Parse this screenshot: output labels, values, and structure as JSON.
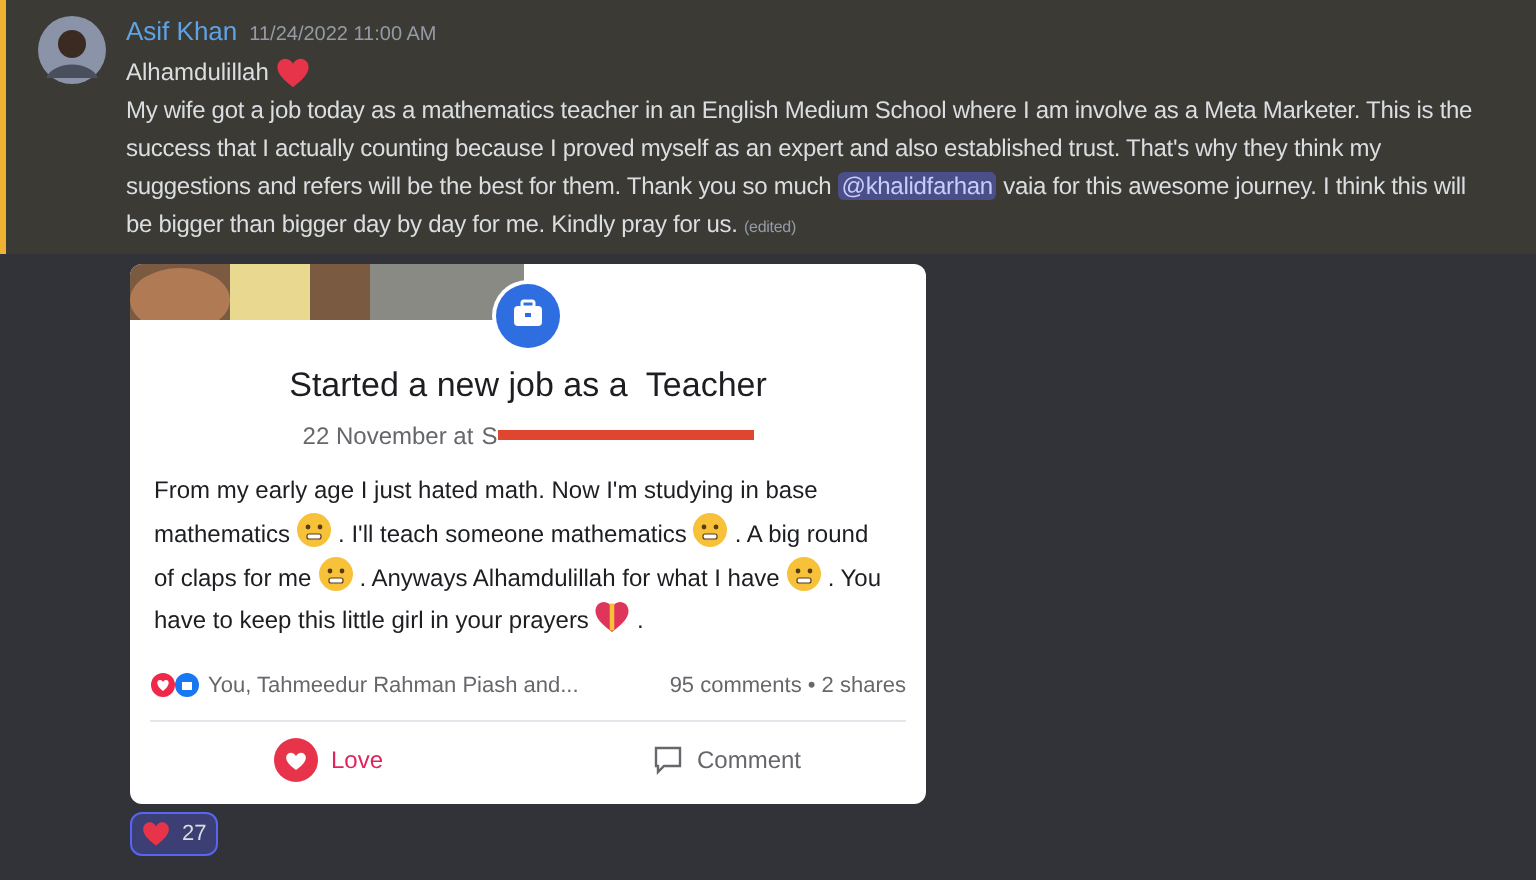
{
  "message": {
    "author": "Asif Khan",
    "timestamp": "11/24/2022 11:00 AM",
    "first_line": "Alhamdulillah",
    "body_before": "My wife got a job today as a mathematics teacher in an English Medium School where I am involve as a Meta Marketer. This is the success that I actually counting because I proved myself as an expert and also established trust. That's why they think my suggestions and refers will be the best for them. Thank you so much",
    "mention": "@khalidfarhan",
    "body_after": "vaia for this awesome journey. I think this will be bigger than bigger day by day for me. Kindly pray for us.",
    "edited": "(edited)",
    "highlighted": true
  },
  "post": {
    "title": "Started a new job as a  Teacher",
    "date": "22 November at",
    "place": "S",
    "place_redacted": true,
    "body": [
      {
        "kind": "text",
        "text": "From my early age I just hated math. Now I'm studying in base mathematics"
      },
      {
        "kind": "face"
      },
      {
        "kind": "text",
        "text": ". I'll teach someone mathematics"
      },
      {
        "kind": "face"
      },
      {
        "kind": "text",
        "text": ". A big round of claps for me"
      },
      {
        "kind": "face"
      },
      {
        "kind": "text",
        "text": ". Anyways Alhamdulillah for what I have"
      },
      {
        "kind": "face"
      },
      {
        "kind": "text",
        "text": ". You have to keep this little girl in your prayers"
      },
      {
        "kind": "heart"
      },
      {
        "kind": "text",
        "text": "."
      }
    ],
    "reactors": "You, Tahmeedur Rahman Piash and...",
    "counts": "95 comments • 2 shares",
    "actions": [
      {
        "label": "Love",
        "selected": true
      },
      {
        "label": "Comment",
        "selected": false
      }
    ]
  },
  "reactions": [
    {
      "count": "27",
      "selected": true
    }
  ]
}
